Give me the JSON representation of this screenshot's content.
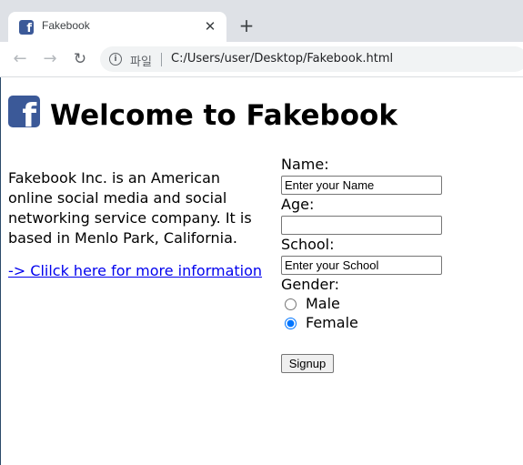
{
  "browser": {
    "tab_title": "Fakebook",
    "tab_close_label": "✕",
    "new_tab_label": "+",
    "scheme_label": "파일",
    "url": "C:/Users/user/Desktop/Fakebook.html"
  },
  "page": {
    "logo_letter": "f",
    "heading": "Welcome to Fakebook",
    "description": "Fakebook Inc. is an American online social media and social networking service company. It is based in Menlo Park, California.",
    "link_text": "-> Clilck here for more information"
  },
  "form": {
    "name_label": "Name:",
    "name_value": "Enter your Name",
    "age_label": "Age:",
    "age_value": "",
    "school_label": "School:",
    "school_value": "Enter your School",
    "gender_label": "Gender:",
    "gender_options": [
      "Male",
      "Female"
    ],
    "gender_selected": "Female",
    "signup_label": "Signup"
  },
  "colors": {
    "brand": "#3b5998",
    "link": "#0000ee",
    "tabstrip": "#dee1e6",
    "radio_accent": "#0075ff"
  },
  "icons": [
    "facebook-icon",
    "close-icon",
    "plus-icon",
    "back-arrow-icon",
    "forward-arrow-icon",
    "reload-icon",
    "info-icon"
  ]
}
